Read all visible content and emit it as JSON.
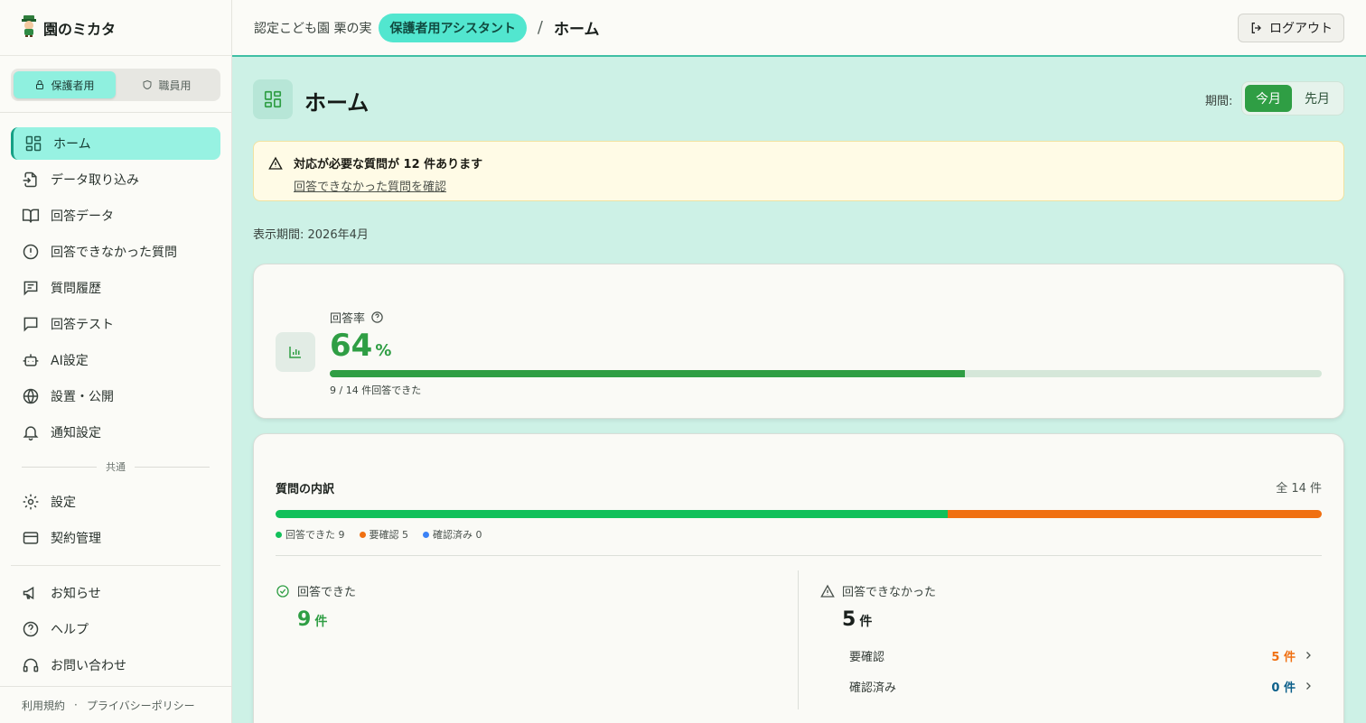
{
  "brand": {
    "title": "園のミカタ"
  },
  "mode_toggle": {
    "guardian": "保護者用",
    "staff": "職員用"
  },
  "nav": {
    "items": [
      {
        "label": "ホーム"
      },
      {
        "label": "データ取り込み"
      },
      {
        "label": "回答データ"
      },
      {
        "label": "回答できなかった質問"
      },
      {
        "label": "質問履歴"
      },
      {
        "label": "回答テスト"
      },
      {
        "label": "AI設定"
      },
      {
        "label": "設置・公開"
      },
      {
        "label": "通知設定"
      }
    ],
    "section_common": "共通",
    "common_items": [
      {
        "label": "設定"
      },
      {
        "label": "契約管理"
      }
    ],
    "support_items": [
      {
        "label": "お知らせ"
      },
      {
        "label": "ヘルプ"
      },
      {
        "label": "お問い合わせ"
      }
    ]
  },
  "footer": {
    "terms": "利用規約",
    "dot": "·",
    "privacy": "プライバシーポリシー"
  },
  "header": {
    "org": "認定こども園 栗の実",
    "assistant": "保護者用アシスタント",
    "separator": "/",
    "crumb": "ホーム",
    "logout": "ログアウト"
  },
  "page": {
    "title": "ホーム",
    "period_label": "期間:",
    "period_options": [
      "今月",
      "先月"
    ],
    "period_selected": "今月",
    "display_period": "表示期間: 2026年4月"
  },
  "alert": {
    "title": "対応が必要な質問が 12 件あります",
    "link": "回答できなかった質問を確認"
  },
  "rate": {
    "label": "回答率",
    "value": "64",
    "unit": "%",
    "progress": 0.64,
    "sub": "9 / 14 件回答できた"
  },
  "breakdown": {
    "title": "質問の内訳",
    "total": "全 14 件",
    "segments": [
      {
        "label": "回答できた 9",
        "value": 9,
        "color": "#12c05a"
      },
      {
        "label": "要確認 5",
        "value": 5,
        "color": "#f07012"
      },
      {
        "label": "確認済み 0",
        "value": 0,
        "color": "#3b82f6"
      }
    ],
    "answered": {
      "label": "回答できた",
      "value": "9",
      "unit": "件"
    },
    "unanswered": {
      "label": "回答できなかった",
      "value": "5",
      "unit": "件"
    },
    "needs_review": {
      "label": "要確認",
      "value": "5 件"
    },
    "reviewed": {
      "label": "確認済み",
      "value": "0 件"
    }
  },
  "colors": {
    "accent": "#2f9e44",
    "teal": "#52e6cf",
    "warning": "#f07012",
    "info": "#0b5f8a"
  }
}
